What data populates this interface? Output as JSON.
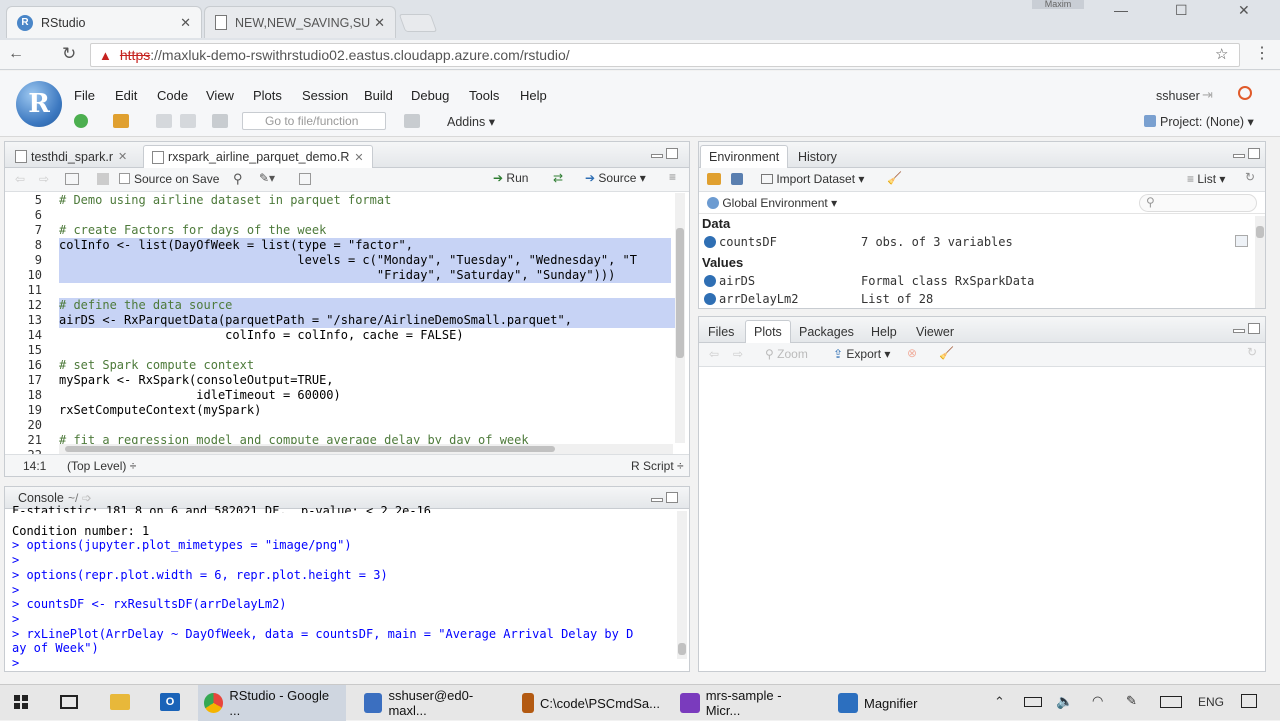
{
  "browser": {
    "tabs": [
      {
        "title": "RStudio",
        "active": true
      },
      {
        "title": "NEW,NEW_SAVING,SUBM",
        "active": false
      }
    ],
    "window_user": "Maxim",
    "url_https": "https",
    "url_rest": "://maxluk-demo-rswithrstudio02.eastus.cloudapp.azure.com/rstudio/"
  },
  "rstudio": {
    "logo": "R",
    "menu": [
      "File",
      "Edit",
      "Code",
      "View",
      "Plots",
      "Session",
      "Build",
      "Debug",
      "Tools",
      "Help"
    ],
    "goto_placeholder": "Go to file/function",
    "addins": "Addins",
    "user": "sshuser",
    "project": "Project: (None)"
  },
  "editor": {
    "tabs": [
      "testhdi_spark.r",
      "rxspark_airline_parquet_demo.R"
    ],
    "source_on_save": "Source on Save",
    "run": "Run",
    "source": "Source",
    "lines": [
      {
        "n": "5",
        "text": "# Demo using airline dataset in parquet format",
        "cls": "cm"
      },
      {
        "n": "6",
        "text": "",
        "cls": ""
      },
      {
        "n": "7",
        "text": "# create Factors for days of the week",
        "cls": "cm"
      },
      {
        "n": "8",
        "text": "colInfo <- list(DayOfWeek = list(type = \"factor\",",
        "cls": ""
      },
      {
        "n": "9",
        "text": "                                 levels = c(\"Monday\", \"Tuesday\", \"Wednesday\", \"T",
        "cls": ""
      },
      {
        "n": "10",
        "text": "                                            \"Friday\", \"Saturday\", \"Sunday\")))",
        "cls": ""
      },
      {
        "n": "11",
        "text": "",
        "cls": ""
      },
      {
        "n": "12",
        "text": "# define the data source",
        "cls": "cm"
      },
      {
        "n": "13",
        "text": "airDS <- RxParquetData(parquetPath = \"/share/AirlineDemoSmall.parquet\",",
        "cls": ""
      },
      {
        "n": "14",
        "text": "                       colInfo = colInfo, cache = FALSE)",
        "cls": ""
      },
      {
        "n": "15",
        "text": "",
        "cls": ""
      },
      {
        "n": "16",
        "text": "# set Spark compute context",
        "cls": "cm"
      },
      {
        "n": "17",
        "text": "mySpark <- RxSpark(consoleOutput=TRUE,",
        "cls": ""
      },
      {
        "n": "18",
        "text": "                   idleTimeout = 60000)",
        "cls": ""
      },
      {
        "n": "19",
        "text": "rxSetComputeContext(mySpark)",
        "cls": ""
      },
      {
        "n": "20",
        "text": "",
        "cls": ""
      },
      {
        "n": "21",
        "text": "# fit a regression model and compute average delay by day of week",
        "cls": "cm"
      },
      {
        "n": "22",
        "text": "",
        "cls": ""
      }
    ],
    "status_pos": "14:1",
    "status_scope": "(Top Level)",
    "status_type": "R Script"
  },
  "console": {
    "title": "Console",
    "path": "~/",
    "lines": [
      {
        "text": "F-statistic: 181.8 on 6 and 582021 DF,  p-value: < 2.2e-16",
        "cls": "out"
      },
      {
        "text": "Condition number: 1",
        "cls": "out"
      },
      {
        "text": "> options(jupyter.plot_mimetypes = \"image/png\")",
        "cls": "in"
      },
      {
        "text": ">",
        "cls": "in"
      },
      {
        "text": "> options(repr.plot.width = 6, repr.plot.height = 3)",
        "cls": "in"
      },
      {
        "text": ">",
        "cls": "in"
      },
      {
        "text": "> countsDF <- rxResultsDF(arrDelayLm2)",
        "cls": "in"
      },
      {
        "text": ">",
        "cls": "in"
      },
      {
        "text": "> rxLinePlot(ArrDelay ~ DayOfWeek, data = countsDF, main = \"Average Arrival Delay by D",
        "cls": "in"
      },
      {
        "text": "ay of Week\")",
        "cls": "in"
      },
      {
        "text": ">",
        "cls": "in"
      }
    ]
  },
  "environment": {
    "tabs": [
      "Environment",
      "History"
    ],
    "import_dataset": "Import Dataset",
    "view_mode": "List",
    "scope": "Global Environment",
    "data_header": "Data",
    "values_header": "Values",
    "data": [
      {
        "name": "countsDF",
        "value": "7 obs. of 3 variables"
      }
    ],
    "values": [
      {
        "name": "airDS",
        "value": "Formal class RxSparkData"
      },
      {
        "name": "arrDelayLm2",
        "value": "List of 28"
      }
    ]
  },
  "files": {
    "tabs": [
      "Files",
      "Plots",
      "Packages",
      "Help",
      "Viewer"
    ],
    "zoom": "Zoom",
    "export": "Export"
  },
  "taskbar": {
    "items": [
      {
        "label": "RStudio - Google ...",
        "color": "#e8453c"
      },
      {
        "label": "sshuser@ed0-maxl...",
        "color": "#3b6fc0"
      },
      {
        "label": "C:\\code\\PSCmdSa...",
        "color": "#b35a12"
      },
      {
        "label": "mrs-sample - Micr...",
        "color": "#7a3bbd"
      },
      {
        "label": "Magnifier",
        "color": "#2c6fbf"
      }
    ],
    "lang": "ENG"
  }
}
